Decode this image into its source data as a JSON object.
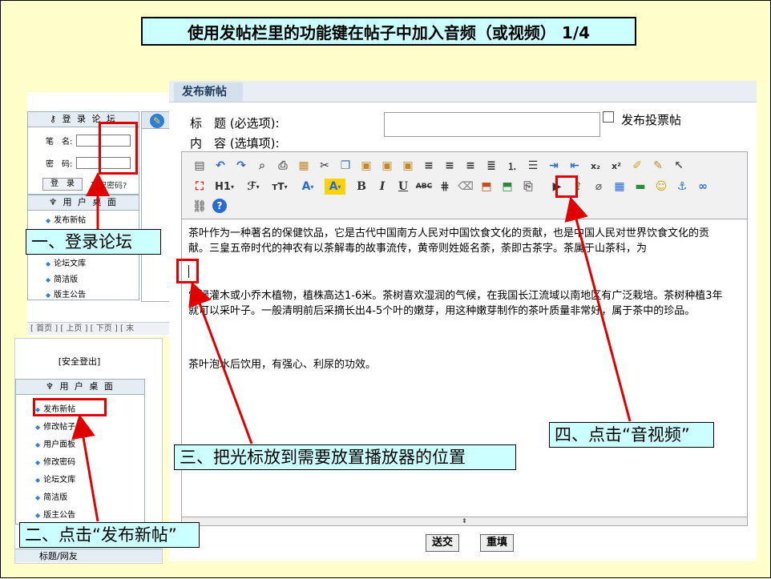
{
  "slide_title": "使用发帖栏里的功能键在帖子中加入音频（或视频） 1/4",
  "callouts": {
    "step1": "一、登录论坛",
    "step2": "二、点击“发布新帖”",
    "step3": "三、把光标放到需要放置播放器的位置",
    "step4": "四、点击“音视频”"
  },
  "login_panel": {
    "header": "登 录 论 坛",
    "user_label": "笔　名:",
    "pass_label": "密　码:",
    "login_button": "登　录",
    "forgot_link": "忘记密码?",
    "desk_header": "用 户 桌 面",
    "nav_items": [
      "发布新帖",
      "论坛文库",
      "简洁版",
      "版主公告"
    ],
    "pager": "[ 首页 ] [ 上页 ] [ 下页 ] [ 末"
  },
  "desk_panel": {
    "logout": "[安全登出]",
    "header": "用 户 桌 面",
    "nav_items": [
      "发布新帖",
      "修改帖子",
      "用户面板",
      "修改密码",
      "论坛文库",
      "简洁版",
      "版主公告"
    ],
    "footer": "标题/网友"
  },
  "editor": {
    "tab": "发布新帖",
    "title_label": "标　题 (必选项):",
    "content_label": "内　容 (选填项):",
    "poll_label": "发布投票帖",
    "toolbar_text": {
      "h1": "H1",
      "bold": "B",
      "italic": "I",
      "underline": "U"
    },
    "paragraphs": [
      "茶叶作为一种著名的保健饮品，它是古代中国南方人民对中国饮食文化的贡献，也是中国人民对世界饮食文化的贡献。三皇五帝时代的神农有以茶解毒的故事流传，黄帝则姓姬名荼，荼即古茶字。茶属于山茶科，为",
      "常绿灌木或小乔木植物，植株高达1-6米。茶树喜欢湿润的气候，在我国长江流域以南地区有广泛栽培。茶树种植3年就可以采叶子。一般清明前后采摘长出4-5个叶的嫩芽，用这种嫩芽制作的茶叶质量非常好，属于茶中的珍品。",
      "茶叶泡水后饮用，有强心、利尿的功效。"
    ],
    "submit": "送交",
    "reset": "重填"
  },
  "colors": {
    "background": "#ffffcc",
    "callout_bg": "#ccffff",
    "highlight": "#e00000"
  }
}
